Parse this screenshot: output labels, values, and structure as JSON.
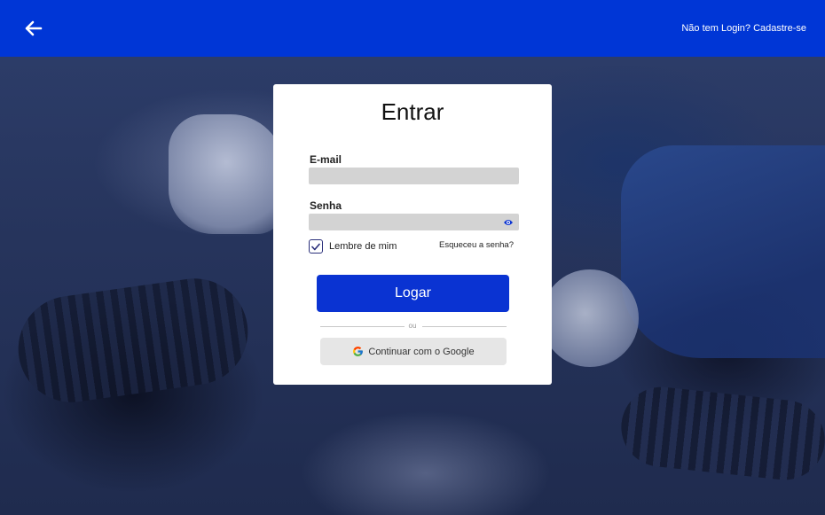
{
  "header": {
    "back_icon": "arrow-left-icon",
    "signup_link": "Não tem Login? Cadastre-se",
    "background_color": "#0036d6"
  },
  "login_card": {
    "title": "Entrar",
    "email": {
      "label": "E-mail",
      "value": "",
      "placeholder": ""
    },
    "password": {
      "label": "Senha",
      "value": "",
      "placeholder": "",
      "toggle_icon": "eye-icon"
    },
    "remember_me": {
      "label": "Lembre de mim",
      "checked": true
    },
    "forgot_password": "Esqueceu a senha?",
    "login_button": "Logar",
    "divider_text": "ou",
    "google_button": {
      "label": "Continuar com o Google",
      "icon": "google-icon"
    }
  },
  "colors": {
    "primary": "#0a33d2",
    "input_bg": "#d3d3d3",
    "google_btn_bg": "#e6e6e6"
  }
}
